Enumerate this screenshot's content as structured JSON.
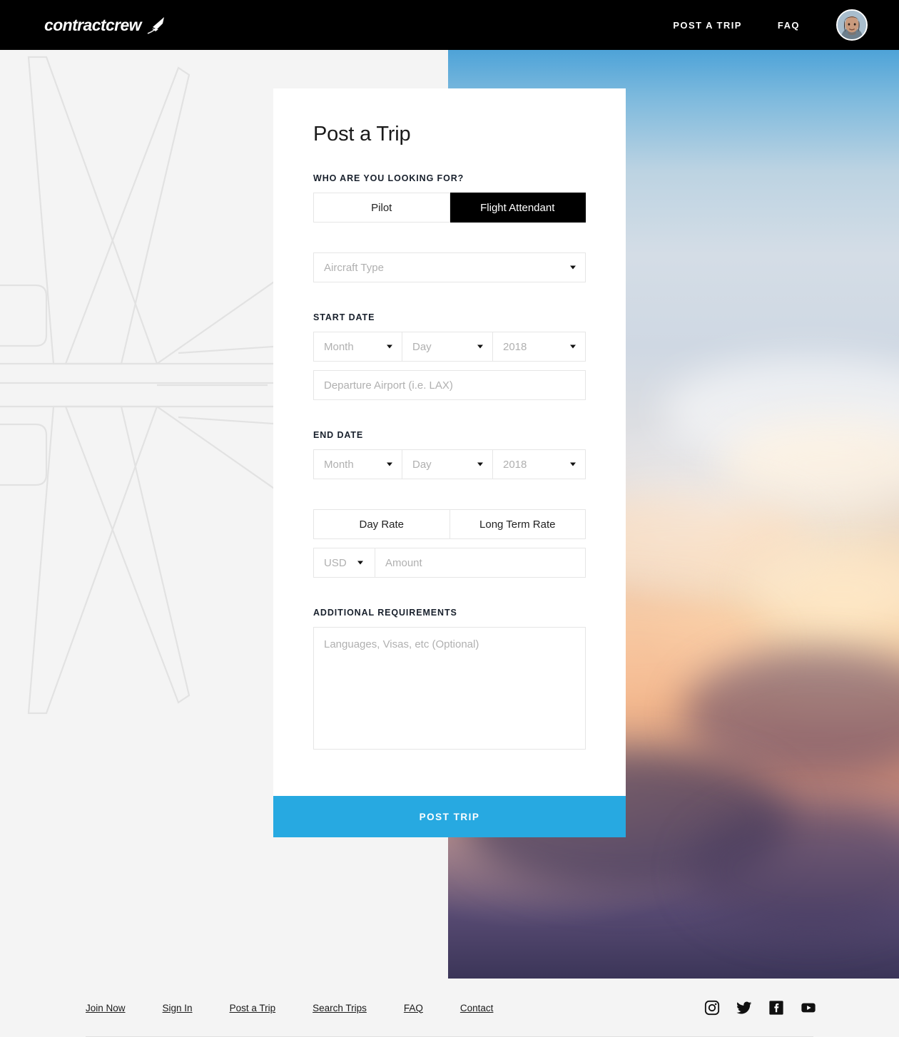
{
  "brand": {
    "logo_text": "contractcrew",
    "logo_icon": "airplane-swoosh-icon"
  },
  "nav": {
    "links": [
      {
        "label": "POST A TRIP",
        "name": "nav-post-a-trip"
      },
      {
        "label": "FAQ",
        "name": "nav-faq"
      }
    ],
    "avatar_icon": "user-avatar-photo"
  },
  "form": {
    "title": "Post a Trip",
    "role_label": "WHO ARE YOU LOOKING FOR?",
    "role_options": [
      {
        "label": "Pilot",
        "selected": false
      },
      {
        "label": "Flight Attendant",
        "selected": true
      }
    ],
    "aircraft_type": {
      "placeholder": "Aircraft Type",
      "value": "Aircraft Type"
    },
    "start_date_label": "START DATE",
    "start_date": {
      "month": "Month",
      "day": "Day",
      "year": "2018"
    },
    "departure_airport": {
      "placeholder": "Departure Airport (i.e. LAX)",
      "value": ""
    },
    "end_date_label": "END DATE",
    "end_date": {
      "month": "Month",
      "day": "Day",
      "year": "2018"
    },
    "rate_options": [
      {
        "label": "Day Rate",
        "selected": false
      },
      {
        "label": "Long Term Rate",
        "selected": false
      }
    ],
    "currency": "USD",
    "amount": {
      "placeholder": "Amount",
      "value": ""
    },
    "requirements_label": "ADDITIONAL REQUIREMENTS",
    "requirements": {
      "placeholder": "Languages, Visas, etc (Optional)",
      "value": ""
    },
    "submit_label": "POST TRIP"
  },
  "footer": {
    "links": [
      {
        "label": "Join Now",
        "name": "footer-join-now"
      },
      {
        "label": "Sign In",
        "name": "footer-sign-in"
      },
      {
        "label": "Post a Trip",
        "name": "footer-post-a-trip"
      },
      {
        "label": "Search Trips",
        "name": "footer-search-trips"
      },
      {
        "label": "FAQ",
        "name": "footer-faq"
      },
      {
        "label": "Contact",
        "name": "footer-contact"
      }
    ],
    "social": [
      {
        "icon": "instagram-icon"
      },
      {
        "icon": "twitter-icon"
      },
      {
        "icon": "facebook-icon"
      },
      {
        "icon": "youtube-icon"
      }
    ]
  },
  "colors": {
    "nav_background": "#000000",
    "accent_button": "#27a9e1",
    "selected_toggle": "#000000",
    "page_background": "#f4f4f4",
    "label_text": "#18202c",
    "placeholder_text": "#b0b0b0"
  },
  "decor": {
    "left_watermark": "aircraft-blueprint-watermark",
    "right_photo": "sunset-sky-clouds-photo"
  }
}
